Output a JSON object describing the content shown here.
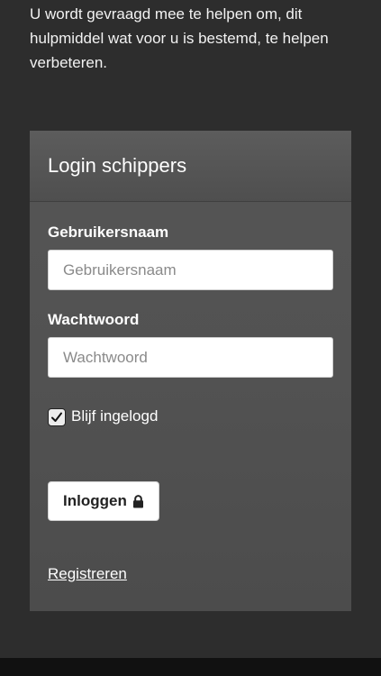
{
  "intro": {
    "text": "U wordt gevraagd mee te helpen om, dit hulpmiddel wat voor u is bestemd, te helpen verbeteren."
  },
  "login_card": {
    "title": "Login schippers",
    "username": {
      "label": "Gebruikersnaam",
      "placeholder": "Gebruikersnaam",
      "value": ""
    },
    "password": {
      "label": "Wachtwoord",
      "placeholder": "Wachtwoord",
      "value": ""
    },
    "remember": {
      "label": "Blijf ingelogd",
      "checked": true
    },
    "login_button": {
      "label": "Inloggen",
      "icon": "lock-icon"
    },
    "register_link": {
      "label": "Registreren"
    }
  },
  "colors": {
    "background": "#2d2d2d",
    "card": "#525252",
    "text": "#ffffff"
  }
}
